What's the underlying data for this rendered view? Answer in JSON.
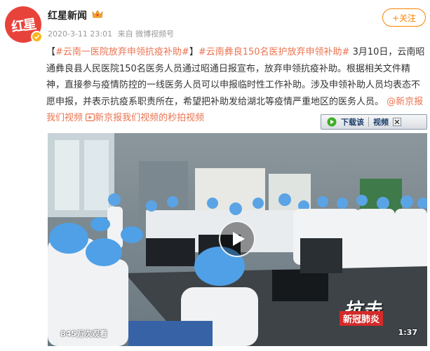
{
  "author": {
    "avatar_text": "红星",
    "name": "红星新闻",
    "badge_icon": "crown-icon",
    "verified_icon": "verified-check-icon"
  },
  "post_meta": {
    "date": "2020-3-11 23:01",
    "source": "来自 微博视频号"
  },
  "follow_button": {
    "label": "+关注",
    "color": "#ff8200"
  },
  "content": {
    "bracket_open": "【",
    "topic1": "#云南一医院放弃申领抗疫补助#",
    "bracket_close": "】",
    "topic2": "#云南彝良150名医护放弃申领补助#",
    "text": " 3月10日，云南昭通彝良县人民医院150名医务人员通过昭通日报宣布，放弃申领抗疫补助。根据相关文件精神，直接参与疫情防控的一线医务人员可以申报临时性工作补助。涉及申领补助人员均表态不愿申报，并表示抗疫系职责所在，希望把补助发给湖北等疫情严重地区的医务人员。",
    "mention": "@新京报我们视频",
    "video_link": "新京报我们视频的秒拍视频",
    "link_color": "#eb7350"
  },
  "download_bar": {
    "download_label": "下载该",
    "video_label": "视频"
  },
  "video": {
    "views": "845万次观看",
    "duration": "1:37",
    "watermark_top": "抗击",
    "watermark_bottom": "新冠肺炎"
  }
}
